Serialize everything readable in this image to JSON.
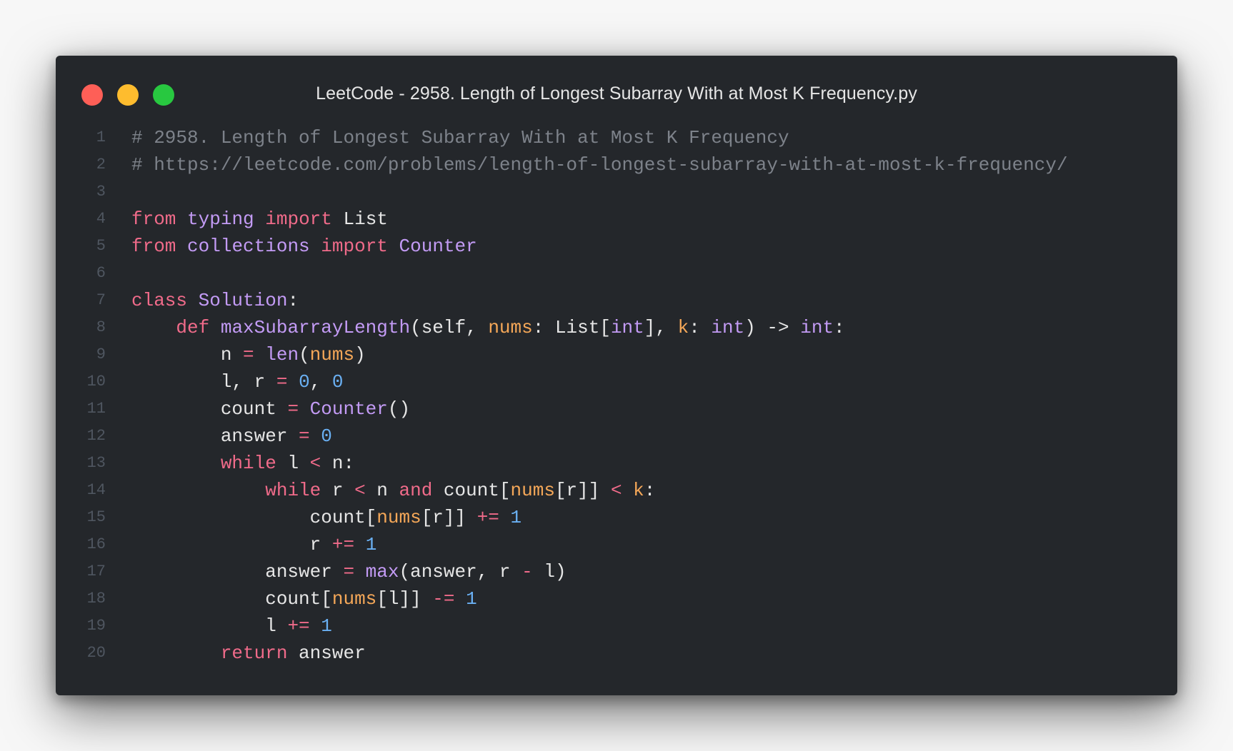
{
  "window": {
    "title": "LeetCode - 2958. Length of Longest Subarray With at Most K Frequency.py"
  },
  "colors": {
    "background": "#24272b",
    "close": "#fe5f57",
    "minimize": "#febc2e",
    "maximize": "#28c840",
    "comment": "#7d828a",
    "keyword": "#f06b8a",
    "class_or_function": "#c39bf5",
    "parameter": "#f4a758",
    "number": "#6ab0f3",
    "plain": "#e6e6e6",
    "line_number": "#4f5660"
  },
  "code": {
    "lines": [
      {
        "n": "1",
        "tokens": [
          {
            "t": "# 2958. Length of Longest Subarray With at Most K Frequency",
            "c": "comment"
          }
        ]
      },
      {
        "n": "2",
        "tokens": [
          {
            "t": "# https://leetcode.com/problems/length-of-longest-subarray-with-at-most-k-frequency/",
            "c": "comment"
          }
        ]
      },
      {
        "n": "3",
        "tokens": []
      },
      {
        "n": "4",
        "tokens": [
          {
            "t": "from",
            "c": "kw"
          },
          {
            "t": " ",
            "c": "plain"
          },
          {
            "t": "typing",
            "c": "cls"
          },
          {
            "t": " ",
            "c": "plain"
          },
          {
            "t": "import",
            "c": "kw"
          },
          {
            "t": " List",
            "c": "plain"
          }
        ]
      },
      {
        "n": "5",
        "tokens": [
          {
            "t": "from",
            "c": "kw"
          },
          {
            "t": " ",
            "c": "plain"
          },
          {
            "t": "collections",
            "c": "cls"
          },
          {
            "t": " ",
            "c": "plain"
          },
          {
            "t": "import",
            "c": "kw"
          },
          {
            "t": " ",
            "c": "plain"
          },
          {
            "t": "Counter",
            "c": "cls"
          }
        ]
      },
      {
        "n": "6",
        "tokens": []
      },
      {
        "n": "7",
        "tokens": [
          {
            "t": "class",
            "c": "kw"
          },
          {
            "t": " ",
            "c": "plain"
          },
          {
            "t": "Solution",
            "c": "cls"
          },
          {
            "t": ":",
            "c": "plain"
          }
        ]
      },
      {
        "n": "8",
        "tokens": [
          {
            "t": "    ",
            "c": "plain"
          },
          {
            "t": "def",
            "c": "kw"
          },
          {
            "t": " ",
            "c": "plain"
          },
          {
            "t": "maxSubarrayLength",
            "c": "fn"
          },
          {
            "t": "(self, ",
            "c": "plain"
          },
          {
            "t": "nums",
            "c": "param"
          },
          {
            "t": ": List[",
            "c": "plain"
          },
          {
            "t": "int",
            "c": "cls"
          },
          {
            "t": "], ",
            "c": "plain"
          },
          {
            "t": "k",
            "c": "param"
          },
          {
            "t": ": ",
            "c": "plain"
          },
          {
            "t": "int",
            "c": "cls"
          },
          {
            "t": ") -> ",
            "c": "plain"
          },
          {
            "t": "int",
            "c": "cls"
          },
          {
            "t": ":",
            "c": "plain"
          }
        ]
      },
      {
        "n": "9",
        "tokens": [
          {
            "t": "        n ",
            "c": "plain"
          },
          {
            "t": "=",
            "c": "op"
          },
          {
            "t": " ",
            "c": "plain"
          },
          {
            "t": "len",
            "c": "fn"
          },
          {
            "t": "(",
            "c": "plain"
          },
          {
            "t": "nums",
            "c": "param"
          },
          {
            "t": ")",
            "c": "plain"
          }
        ]
      },
      {
        "n": "10",
        "tokens": [
          {
            "t": "        l, r ",
            "c": "plain"
          },
          {
            "t": "=",
            "c": "op"
          },
          {
            "t": " ",
            "c": "plain"
          },
          {
            "t": "0",
            "c": "num"
          },
          {
            "t": ", ",
            "c": "plain"
          },
          {
            "t": "0",
            "c": "num"
          }
        ]
      },
      {
        "n": "11",
        "tokens": [
          {
            "t": "        count ",
            "c": "plain"
          },
          {
            "t": "=",
            "c": "op"
          },
          {
            "t": " ",
            "c": "plain"
          },
          {
            "t": "Counter",
            "c": "cls"
          },
          {
            "t": "()",
            "c": "plain"
          }
        ]
      },
      {
        "n": "12",
        "tokens": [
          {
            "t": "        answer ",
            "c": "plain"
          },
          {
            "t": "=",
            "c": "op"
          },
          {
            "t": " ",
            "c": "plain"
          },
          {
            "t": "0",
            "c": "num"
          }
        ]
      },
      {
        "n": "13",
        "tokens": [
          {
            "t": "        ",
            "c": "plain"
          },
          {
            "t": "while",
            "c": "kw"
          },
          {
            "t": " l ",
            "c": "plain"
          },
          {
            "t": "<",
            "c": "op"
          },
          {
            "t": " n:",
            "c": "plain"
          }
        ]
      },
      {
        "n": "14",
        "tokens": [
          {
            "t": "            ",
            "c": "plain"
          },
          {
            "t": "while",
            "c": "kw"
          },
          {
            "t": " r ",
            "c": "plain"
          },
          {
            "t": "<",
            "c": "op"
          },
          {
            "t": " n ",
            "c": "plain"
          },
          {
            "t": "and",
            "c": "kw"
          },
          {
            "t": " count[",
            "c": "plain"
          },
          {
            "t": "nums",
            "c": "param"
          },
          {
            "t": "[r]] ",
            "c": "plain"
          },
          {
            "t": "<",
            "c": "op"
          },
          {
            "t": " ",
            "c": "plain"
          },
          {
            "t": "k",
            "c": "param"
          },
          {
            "t": ":",
            "c": "plain"
          }
        ]
      },
      {
        "n": "15",
        "tokens": [
          {
            "t": "                count[",
            "c": "plain"
          },
          {
            "t": "nums",
            "c": "param"
          },
          {
            "t": "[r]] ",
            "c": "plain"
          },
          {
            "t": "+=",
            "c": "op"
          },
          {
            "t": " ",
            "c": "plain"
          },
          {
            "t": "1",
            "c": "num"
          }
        ]
      },
      {
        "n": "16",
        "tokens": [
          {
            "t": "                r ",
            "c": "plain"
          },
          {
            "t": "+=",
            "c": "op"
          },
          {
            "t": " ",
            "c": "plain"
          },
          {
            "t": "1",
            "c": "num"
          }
        ]
      },
      {
        "n": "17",
        "tokens": [
          {
            "t": "            answer ",
            "c": "plain"
          },
          {
            "t": "=",
            "c": "op"
          },
          {
            "t": " ",
            "c": "plain"
          },
          {
            "t": "max",
            "c": "fn"
          },
          {
            "t": "(answer, r ",
            "c": "plain"
          },
          {
            "t": "-",
            "c": "op"
          },
          {
            "t": " l)",
            "c": "plain"
          }
        ]
      },
      {
        "n": "18",
        "tokens": [
          {
            "t": "            count[",
            "c": "plain"
          },
          {
            "t": "nums",
            "c": "param"
          },
          {
            "t": "[l]] ",
            "c": "plain"
          },
          {
            "t": "-=",
            "c": "op"
          },
          {
            "t": " ",
            "c": "plain"
          },
          {
            "t": "1",
            "c": "num"
          }
        ]
      },
      {
        "n": "19",
        "tokens": [
          {
            "t": "            l ",
            "c": "plain"
          },
          {
            "t": "+=",
            "c": "op"
          },
          {
            "t": " ",
            "c": "plain"
          },
          {
            "t": "1",
            "c": "num"
          }
        ]
      },
      {
        "n": "20",
        "tokens": [
          {
            "t": "        ",
            "c": "plain"
          },
          {
            "t": "return",
            "c": "kw"
          },
          {
            "t": " answer",
            "c": "plain"
          }
        ]
      }
    ]
  }
}
